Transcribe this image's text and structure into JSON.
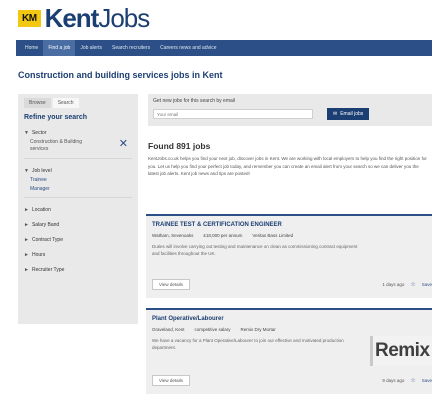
{
  "logo": {
    "badge": "KM",
    "kent": "Kent",
    "jobs": "Jobs"
  },
  "nav": [
    "Home",
    "Find a job",
    "Job alerts",
    "Search recruiters",
    "Careers news and advice"
  ],
  "page_title": "Construction and building services jobs in Kent",
  "sidebar": {
    "tabs": [
      "Browse",
      "Search"
    ],
    "heading": "Refine your search",
    "sector_label": "Sector",
    "sector_selected": "Construction & Building services",
    "job_level_label": "Job level",
    "job_levels": [
      "Trainee",
      "Manager"
    ],
    "facets": [
      "Location",
      "Salary Band",
      "Contract Type",
      "Hours",
      "Recruiter Type"
    ]
  },
  "alert": {
    "label": "Get new jobs for this search by email",
    "placeholder": "Your email",
    "button": "Email jobs"
  },
  "results": {
    "found": "Found 891 jobs",
    "intro": "KentJobs.co.uk helps you find your next job, discover jobs in Kent. We are working with local employers to help you find the right position for you. Let us help you find your perfect job today, and remember you can create an email alert from your search so we can deliver you the latest job alerts. Kent job news and tips are posted!"
  },
  "jobs": [
    {
      "title": "TRAINEE TEST & CERTIFICATION ENGINEER",
      "location": "Watham, Sevenoaks",
      "salary": "£18,000 per annum",
      "company": "Veritas Bass Limited",
      "description": "Duties will involve carrying out testing and maintenance on clean as commissioning contract equipment and facilities throughout the UK.",
      "view": "View details",
      "posted": "1 days ago",
      "save": "Save"
    },
    {
      "title": "Plant Operative/Labourer",
      "location": "Graveland, Kent",
      "salary": "competitive salary",
      "company": "Remix Dry Mortar",
      "description": "We have a vacancy for a Plant Operative/Labourer to join our effective and motivated production department.",
      "view": "View details",
      "posted": "9 days ago",
      "save": "Save",
      "logo_text": "Remix"
    }
  ],
  "colors": {
    "brand": "#1c3f73",
    "nav": "#2b4f86",
    "badge": "#f2c811"
  },
  "icons": {
    "close": "close-icon",
    "envelope": "envelope-icon",
    "star": "star-icon",
    "triangle": "triangle-icon"
  }
}
